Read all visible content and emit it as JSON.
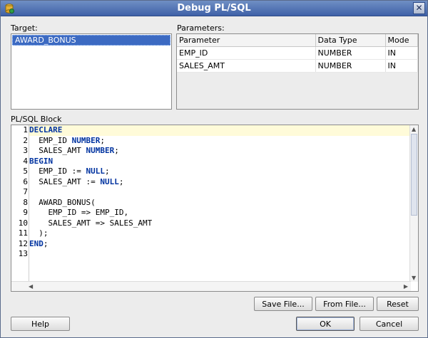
{
  "window": {
    "title": "Debug PL/SQL",
    "close_glyph": "✕"
  },
  "target": {
    "label": "Target:",
    "items": [
      "AWARD_BONUS"
    ]
  },
  "parameters": {
    "label": "Parameters:",
    "columns": [
      "Parameter",
      "Data Type",
      "Mode"
    ],
    "rows": [
      [
        "EMP_ID",
        "NUMBER",
        "IN"
      ],
      [
        "SALES_AMT",
        "NUMBER",
        "IN"
      ]
    ]
  },
  "plsql_block": {
    "label": "PL/SQL Block",
    "current_line": 1,
    "lines": [
      "DECLARE",
      "  EMP_ID NUMBER;",
      "  SALES_AMT NUMBER;",
      "BEGIN",
      "  EMP_ID := NULL;",
      "  SALES_AMT := NULL;",
      "",
      "  AWARD_BONUS(",
      "    EMP_ID => EMP_ID,",
      "    SALES_AMT => SALES_AMT",
      "  );",
      "END;",
      ""
    ]
  },
  "buttons": {
    "save_file": "Save File...",
    "from_file": "From File...",
    "reset": "Reset",
    "help": "Help",
    "ok": "OK",
    "cancel": "Cancel"
  },
  "colors": {
    "title_bar": "#3f61a8",
    "selection": "#3c6ac2",
    "keyword": "#0033a0",
    "current_line": "#fffbd9"
  }
}
